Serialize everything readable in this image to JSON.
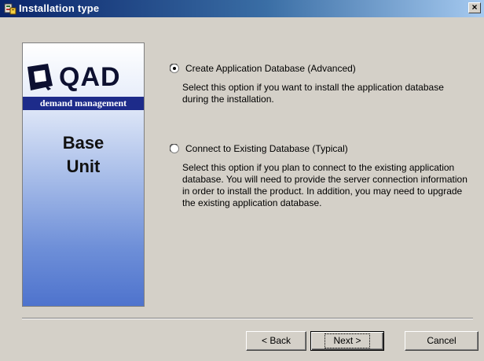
{
  "window": {
    "title": "Installation type",
    "close_glyph": "×",
    "title_icon": "installer-icon"
  },
  "banner": {
    "logo_text": "QAD",
    "logo_subtitle": "demand management",
    "product_name": "Base\nUnit",
    "logo_icon": "qad-logo-mark"
  },
  "options": [
    {
      "label": "Create Application Database  (Advanced)",
      "description": "Select this option if you want to install the application database during the installation.",
      "selected": true
    },
    {
      "label": "Connect to Existing Database (Typical)",
      "description": "Select this option if you plan to connect to the existing application database. You will need to provide the server connection information in order to install the product. In addition, you may need to upgrade the existing application database.",
      "selected": false
    }
  ],
  "buttons": {
    "back": "< Back",
    "next": "Next >",
    "cancel": "Cancel"
  }
}
